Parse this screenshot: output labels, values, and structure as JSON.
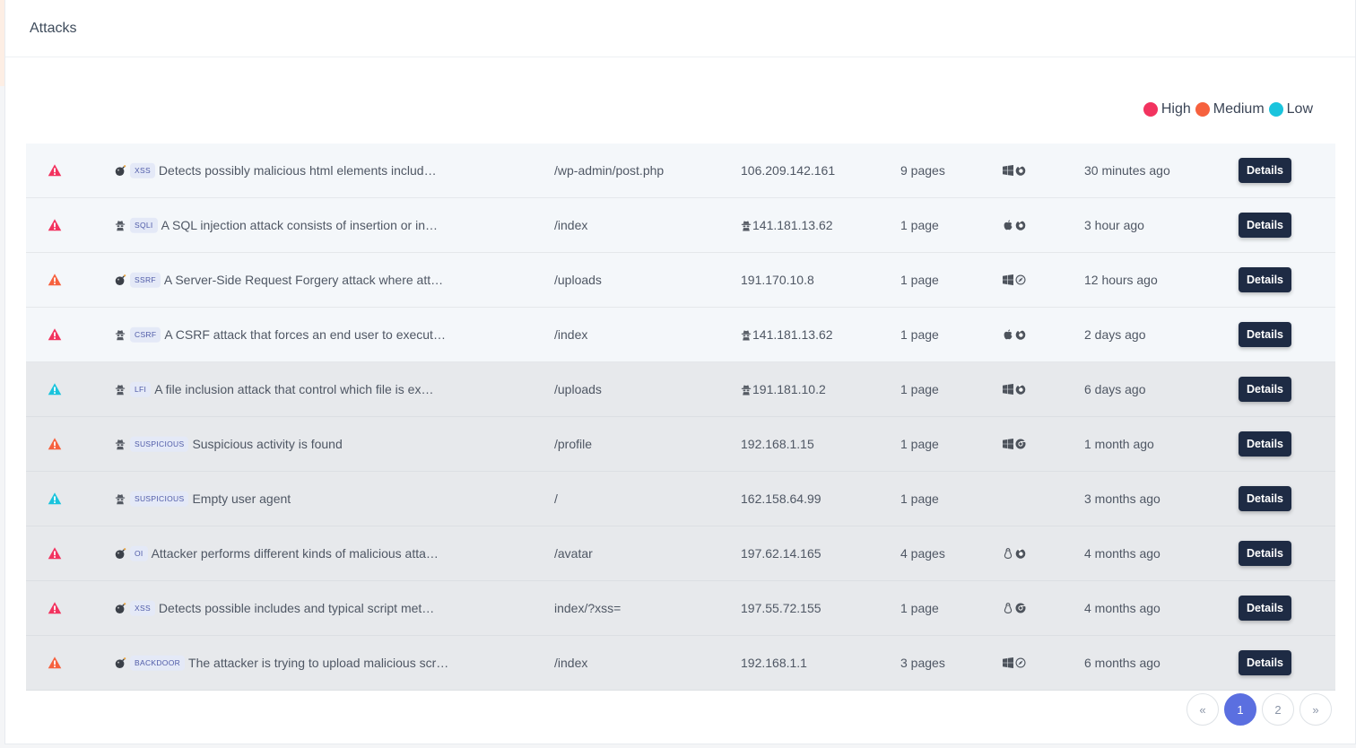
{
  "card": {
    "title": "Attacks"
  },
  "legend": [
    {
      "label": "High",
      "color": "#f2335f"
    },
    {
      "label": "Medium",
      "color": "#f6613e"
    },
    {
      "label": "Low",
      "color": "#1ac4dd"
    }
  ],
  "rows": [
    {
      "severity": "high",
      "type_icon": "bomb-icon",
      "tag": "XSS",
      "desc": "Detects possibly malicious html elements includ…",
      "path": "/wp-admin/post.php",
      "ip": "106.209.142.161",
      "ip_icon": null,
      "pages": "9 pages",
      "os": "windows-icon",
      "browser": "firefox-icon",
      "time": "30 minutes ago",
      "action": "Details"
    },
    {
      "severity": "high",
      "type_icon": "spy-icon",
      "tag": "SQLI",
      "desc": "A SQL injection attack consists of insertion or in…",
      "path": "/index",
      "ip": "141.181.13.62",
      "ip_icon": "spy-icon",
      "pages": "1 page",
      "os": "apple-icon",
      "browser": "firefox-icon",
      "time": "3 hour ago",
      "action": "Details"
    },
    {
      "severity": "medium",
      "type_icon": "bomb-icon",
      "tag": "SSRF",
      "desc": "A Server-Side Request Forgery attack where att…",
      "path": "/uploads",
      "ip": "191.170.10.8",
      "ip_icon": null,
      "pages": "1 page",
      "os": "windows-icon",
      "browser": "safari-icon",
      "time": "12 hours ago",
      "action": "Details"
    },
    {
      "severity": "high",
      "type_icon": "spy-icon",
      "tag": "CSRF",
      "desc": "A CSRF attack that forces an end user to execut…",
      "path": "/index",
      "ip": "141.181.13.62",
      "ip_icon": "spy-icon",
      "pages": "1 page",
      "os": "apple-icon",
      "browser": "firefox-icon",
      "time": "2 days ago",
      "action": "Details"
    },
    {
      "severity": "low",
      "type_icon": "spy-icon",
      "tag": "LFI",
      "desc": "A file inclusion attack that control which file is ex…",
      "path": "/uploads",
      "ip": "191.181.10.2",
      "ip_icon": "spy-icon",
      "pages": "1 page",
      "os": "windows-icon",
      "browser": "firefox-icon",
      "time": "6 days ago",
      "action": "Details"
    },
    {
      "severity": "medium",
      "type_icon": "spy-icon",
      "tag": "SUSPICIOUS",
      "desc": "Suspicious activity is found",
      "path": "/profile",
      "ip": "192.168.1.15",
      "ip_icon": null,
      "pages": "1 page",
      "os": "windows-icon",
      "browser": "chrome-icon",
      "time": "1 month ago",
      "action": "Details"
    },
    {
      "severity": "low",
      "type_icon": "spy-icon",
      "tag": "SUSPICIOUS",
      "desc": "Empty user agent",
      "path": "/",
      "ip": "162.158.64.99",
      "ip_icon": null,
      "pages": "1 page",
      "os": null,
      "browser": null,
      "time": "3 months ago",
      "action": "Details"
    },
    {
      "severity": "high",
      "type_icon": "bomb-icon",
      "tag": "OI",
      "desc": "Attacker performs different kinds of malicious atta…",
      "path": "/avatar",
      "ip": "197.62.14.165",
      "ip_icon": null,
      "pages": "4 pages",
      "os": "linux-icon",
      "browser": "firefox-icon",
      "time": "4 months ago",
      "action": "Details"
    },
    {
      "severity": "high",
      "type_icon": "bomb-icon",
      "tag": "XSS",
      "desc": "Detects possible includes and typical script met…",
      "path": "index/?xss=",
      "ip": "197.55.72.155",
      "ip_icon": null,
      "pages": "1 page",
      "os": "linux-icon",
      "browser": "chrome-icon",
      "time": "4 months ago",
      "action": "Details"
    },
    {
      "severity": "medium",
      "type_icon": "bomb-icon",
      "tag": "BACKDOOR",
      "desc": "The attacker is trying to upload malicious scr…",
      "path": "/index",
      "ip": "192.168.1.1",
      "ip_icon": null,
      "pages": "3 pages",
      "os": "windows-icon",
      "browser": "safari-icon",
      "time": "6 months ago",
      "action": "Details"
    }
  ],
  "pagination": {
    "prev": "«",
    "pages": [
      "1",
      "2"
    ],
    "active": "1",
    "next": "»"
  }
}
